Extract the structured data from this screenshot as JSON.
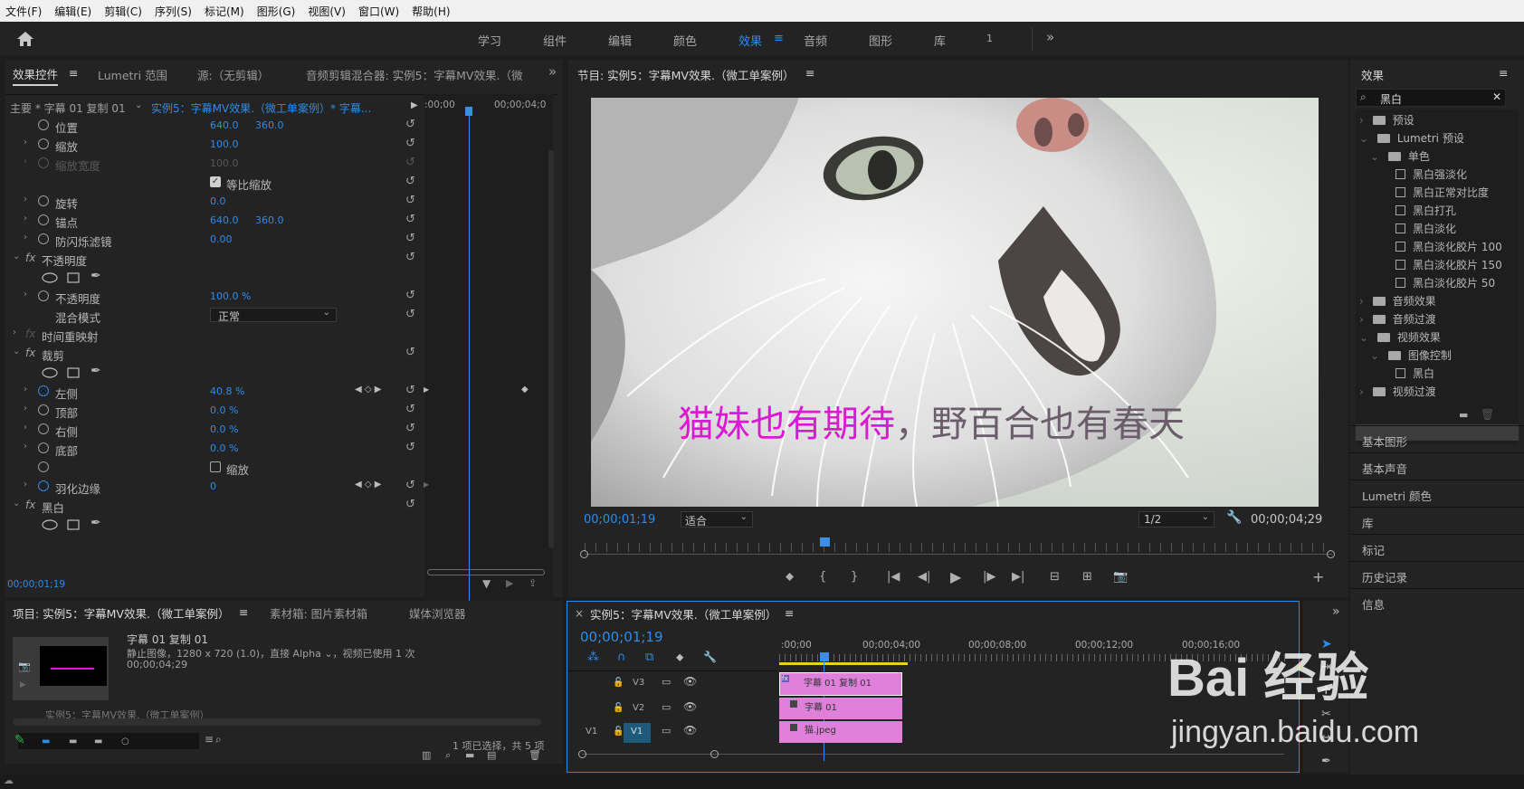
{
  "menu": [
    "文件(F)",
    "编辑(E)",
    "剪辑(C)",
    "序列(S)",
    "标记(M)",
    "图形(G)",
    "视图(V)",
    "窗口(W)",
    "帮助(H)"
  ],
  "workspaces": {
    "items": [
      "学习",
      "组件",
      "编辑",
      "颜色",
      "效果",
      "音频",
      "图形",
      "库",
      "1"
    ],
    "active": "效果",
    "more": "»"
  },
  "effect_controls": {
    "tabs": [
      "效果控件",
      "Lumetri 范围",
      "源:（无剪辑）",
      "音频剪辑混合器: 实例5：字幕MV效果.（微"
    ],
    "menu_icon": "≡",
    "more": "»",
    "master": "主要 * 字幕 01 复制 01",
    "clip": "实例5：字幕MV效果.（微工单案例）* 字幕...",
    "time_start": ":00;00",
    "time_end": "00;00;04;0",
    "rows": [
      {
        "label": "位置",
        "v1": "640.0",
        "v2": "360.0"
      },
      {
        "label": "缩放",
        "v1": "100.0",
        "v2": ""
      },
      {
        "label": "缩放宽度",
        "v1": "100.0",
        "v2": ""
      },
      {
        "label": "等比缩放",
        "v1": "",
        "v2": ""
      },
      {
        "label": "旋转",
        "v1": "0.0",
        "v2": ""
      },
      {
        "label": "锚点",
        "v1": "640.0",
        "v2": "360.0"
      },
      {
        "label": "防闪烁滤镜",
        "v1": "0.00",
        "v2": ""
      },
      {
        "label": "不透明度",
        "v1": "",
        "v2": ""
      },
      {
        "label": "不透明度",
        "v1": "100.0 %",
        "v2": ""
      },
      {
        "label": "混合模式",
        "v1": "正常",
        "v2": ""
      },
      {
        "label": "时间重映射",
        "v1": "",
        "v2": ""
      },
      {
        "label": "裁剪",
        "v1": "",
        "v2": ""
      },
      {
        "label": "左侧",
        "v1": "40.8 %",
        "v2": ""
      },
      {
        "label": "顶部",
        "v1": "0.0 %",
        "v2": ""
      },
      {
        "label": "右侧",
        "v1": "0.0 %",
        "v2": ""
      },
      {
        "label": "底部",
        "v1": "0.0 %",
        "v2": ""
      },
      {
        "label": "缩放",
        "v1": "",
        "v2": ""
      },
      {
        "label": "羽化边缘",
        "v1": "0",
        "v2": ""
      },
      {
        "label": "黑白",
        "v1": "",
        "v2": ""
      }
    ],
    "timecode": "00;00;01;19"
  },
  "program": {
    "title": "节目: 实例5：字幕MV效果.（微工单案例）",
    "menu_icon": "≡",
    "caption_pink": "猫妹也有期待",
    "caption_gray": "，野百合也有春天",
    "timecode": "00;00;01;19",
    "fit": "适合",
    "resolution": "1/2",
    "duration": "00;00;04;29",
    "colors": {
      "pink": "#d81ad2",
      "gray": "#6a5e6a"
    }
  },
  "effects_panel": {
    "title": "效果",
    "menu_icon": "≡",
    "search": "黑白",
    "tree": [
      {
        "label": "预设",
        "kind": "folder-star",
        "depth": 0,
        "open": false
      },
      {
        "label": "Lumetri 预设",
        "kind": "folder-star",
        "depth": 0,
        "open": true
      },
      {
        "label": "单色",
        "kind": "folder-star",
        "depth": 1,
        "open": true
      },
      {
        "label": "黑白强淡化",
        "kind": "preset",
        "depth": 2
      },
      {
        "label": "黑白正常对比度",
        "kind": "preset",
        "depth": 2
      },
      {
        "label": "黑白打孔",
        "kind": "preset",
        "depth": 2
      },
      {
        "label": "黑白淡化",
        "kind": "preset",
        "depth": 2
      },
      {
        "label": "黑白淡化胶片 100",
        "kind": "preset",
        "depth": 2
      },
      {
        "label": "黑白淡化胶片 150",
        "kind": "preset",
        "depth": 2
      },
      {
        "label": "黑白淡化胶片 50",
        "kind": "preset",
        "depth": 2
      },
      {
        "label": "音频效果",
        "kind": "folder",
        "depth": 0,
        "open": false
      },
      {
        "label": "音频过渡",
        "kind": "folder",
        "depth": 0,
        "open": false
      },
      {
        "label": "视频效果",
        "kind": "folder",
        "depth": 0,
        "open": true
      },
      {
        "label": "图像控制",
        "kind": "folder",
        "depth": 1,
        "open": true
      },
      {
        "label": "黑白",
        "kind": "effect",
        "depth": 2,
        "selected": true
      },
      {
        "label": "视频过渡",
        "kind": "folder",
        "depth": 0,
        "open": false
      }
    ],
    "panels": [
      "基本图形",
      "基本声音",
      "Lumetri 颜色",
      "库",
      "标记",
      "历史记录",
      "信息"
    ]
  },
  "project": {
    "tabs": [
      "项目: 实例5：字幕MV效果.（微工单案例）",
      "素材箱: 图片素材箱",
      "媒体浏览器"
    ],
    "menu_icon": "≡",
    "clip_name": "字幕 01 复制 01",
    "clip_info": "静止图像，1280 x 720 (1.0)，直接 Alpha ⌄，视频已使用 1 次",
    "clip_duration": "00;00;04;29",
    "bottom_item": "实例5：字幕MV效果.（微工单案例）",
    "status": "1 项已选择，共 5 项"
  },
  "timeline": {
    "title": "实例5：字幕MV效果.（微工单案例）",
    "close": "×",
    "menu_icon": "≡",
    "timecode": "00;00;01;19",
    "ruler": [
      ":00;00",
      "00;00;04;00",
      "00;00;08;00",
      "00;00;12;00",
      "00;00;16;00"
    ],
    "tracks": [
      {
        "name": "V3",
        "clip": "字幕 01 复制 01",
        "src": ""
      },
      {
        "name": "V2",
        "clip": "字幕 01",
        "src": ""
      },
      {
        "name": "V1",
        "clip": "猫.jpeg",
        "src": "V1"
      }
    ],
    "more": "»"
  },
  "watermark": {
    "text": "Bai 经验",
    "url": "jingyan.baidu.com"
  }
}
